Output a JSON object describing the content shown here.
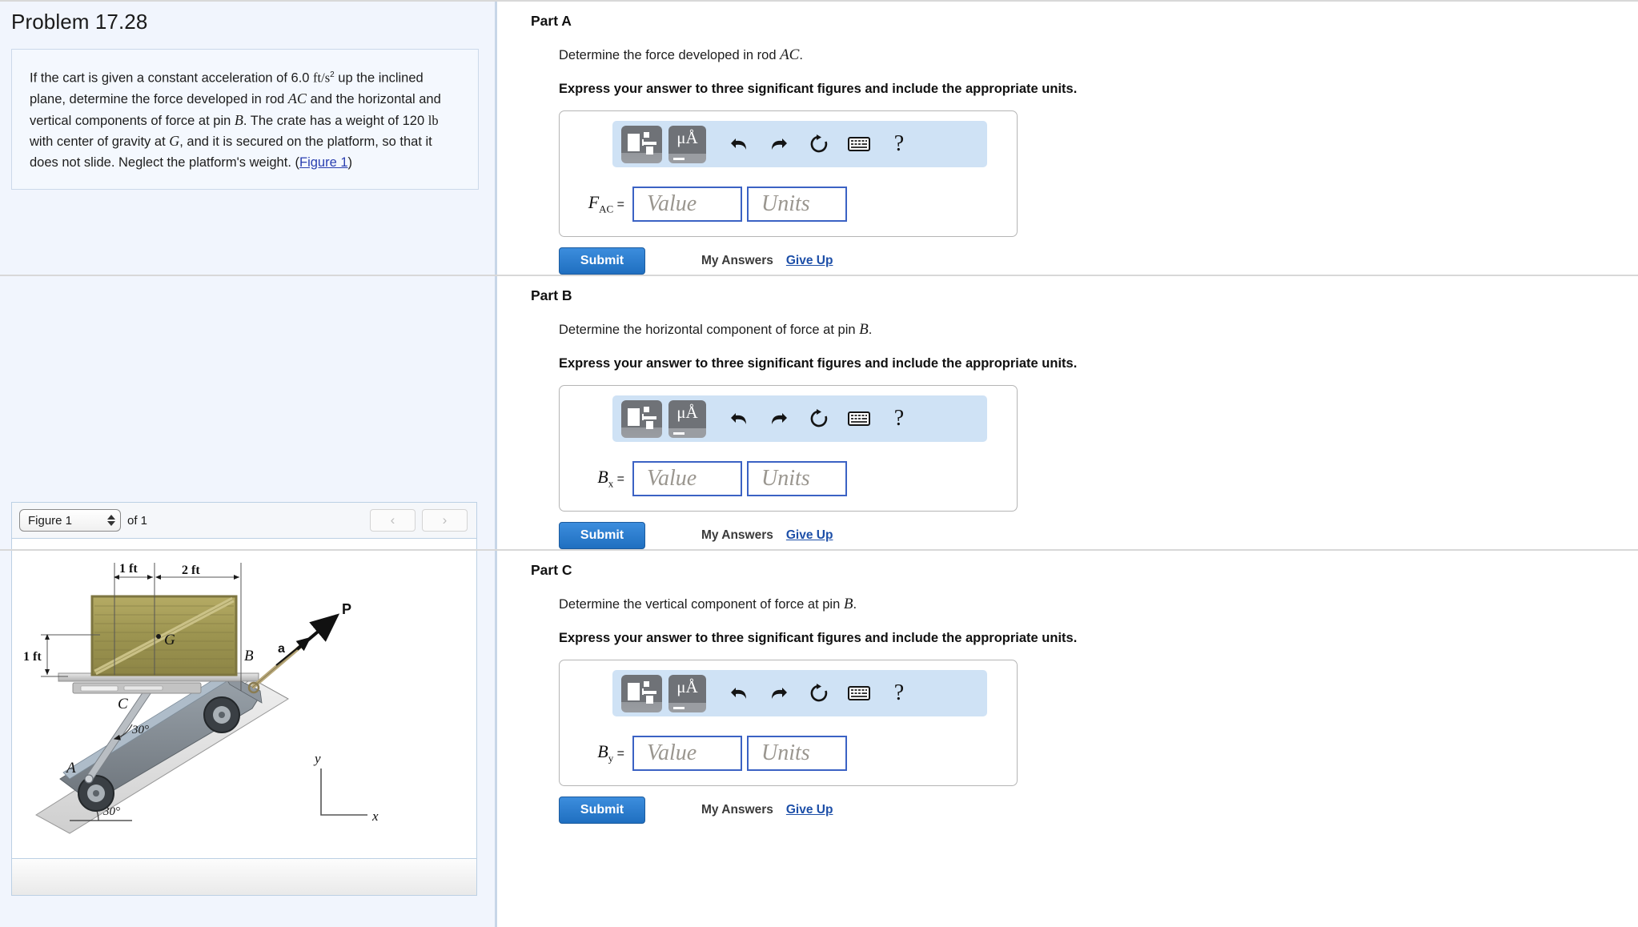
{
  "problem": {
    "title": "Problem 17.28",
    "statement_parts": {
      "s1": "If the cart is given a constant acceleration of 6.0 ",
      "accel_units": "ft/s",
      "accel_exp": "2",
      "s2": " up the inclined plane, determine the force developed in rod ",
      "rod": "AC",
      "s3": " and the horizontal and vertical components of force at pin ",
      "pin": "B",
      "s4": ". The crate has a weight of 120 ",
      "weight_units": "lb",
      "s5": " with center of gravity at ",
      "cg": "G",
      "s6": ", and it is secured on the platform, so that it does not slide. Neglect the platform's weight. (",
      "figure_link": "Figure 1",
      "s7": ")"
    }
  },
  "figure_panel": {
    "selected_figure": "Figure 1",
    "of_label": "of 1",
    "prev_label": "‹",
    "next_label": "›",
    "diagram": {
      "dim_top_1": "1 ft",
      "dim_top_2": "2 ft",
      "dim_left": "1 ft",
      "label_G": "G",
      "label_B": "B",
      "label_C": "C",
      "label_A": "A",
      "label_P": "P",
      "label_a": "a",
      "angle_rod": "30°",
      "angle_incline": "30°",
      "axis_y": "y",
      "axis_x": "x"
    }
  },
  "mathbar": {
    "template_icon": "template-chooser-icon",
    "units_label": "μÅ",
    "undo_icon": "undo-icon",
    "redo_icon": "redo-icon",
    "reset_icon": "reset-icon",
    "keyboard_icon": "keyboard-icon",
    "help_label": "?"
  },
  "common": {
    "instruction": "Express your answer to three significant figures and include the appropriate units.",
    "value_placeholder": "Value",
    "units_placeholder": "Units",
    "submit_label": "Submit",
    "my_answers_label": "My Answers",
    "give_up_label": "Give Up"
  },
  "parts": [
    {
      "heading": "Part A",
      "prompt_pre": "Determine the force developed in rod ",
      "prompt_var": "AC",
      "prompt_post": ".",
      "var_main": "F",
      "var_sub": "AC"
    },
    {
      "heading": "Part B",
      "prompt_pre": "Determine the horizontal component of force at pin ",
      "prompt_var": "B",
      "prompt_post": ".",
      "var_main": "B",
      "var_sub": "x"
    },
    {
      "heading": "Part C",
      "prompt_pre": "Determine the vertical component of force at pin ",
      "prompt_var": "B",
      "prompt_post": ".",
      "var_main": "B",
      "var_sub": "y"
    }
  ],
  "colors": {
    "panel_bg": "#f1f5fd",
    "mathbar_bg": "#cfe2f5",
    "input_border": "#3b62c4",
    "submit_blue": "#2b7ccc",
    "link_blue": "#1d4fa8"
  }
}
